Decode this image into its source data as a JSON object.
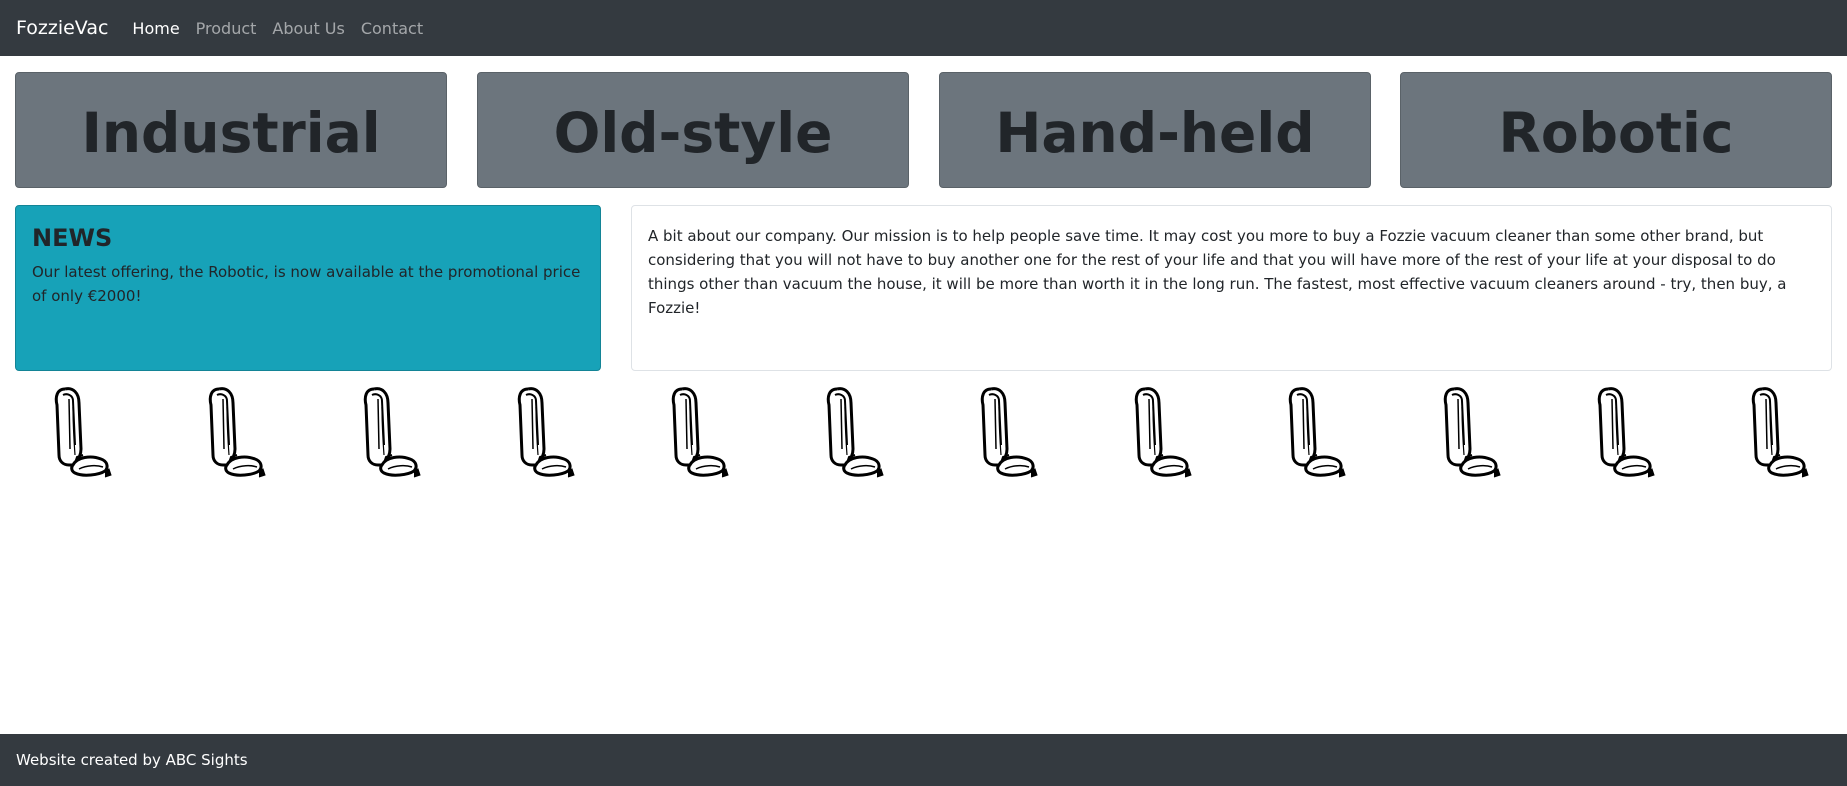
{
  "navbar": {
    "brand": "FozzieVac",
    "links": [
      {
        "label": "Home",
        "active": true
      },
      {
        "label": "Product",
        "active": false
      },
      {
        "label": "About Us",
        "active": false
      },
      {
        "label": "Contact",
        "active": false
      }
    ]
  },
  "categories": [
    "Industrial",
    "Old-style",
    "Hand-held",
    "Robotic"
  ],
  "news": {
    "title": "NEWS",
    "text": "Our latest offering, the Robotic, is now available at the promotional price of only €2000!"
  },
  "about": {
    "text": "A bit about our company. Our mission is to help people save time. It may cost you more to buy a Fozzie vacuum cleaner than some other brand, but considering that you will not have to buy another one for the rest of your life and that you will have more of the rest of your life at your disposal to do things other than vacuum the house, it will be more than worth it in the long run. The fastest, most effective vacuum cleaners around - try, then buy, a Fozzie!"
  },
  "vacuum_images": {
    "count": 12,
    "icon": "upright-vacuum-icon"
  },
  "footer": {
    "text": "Website created by ABC Sights"
  },
  "colors": {
    "navbar_bg": "#343a40",
    "category_bg": "#6c757d",
    "news_bg": "#17a2b8",
    "footer_bg": "#343a40"
  }
}
